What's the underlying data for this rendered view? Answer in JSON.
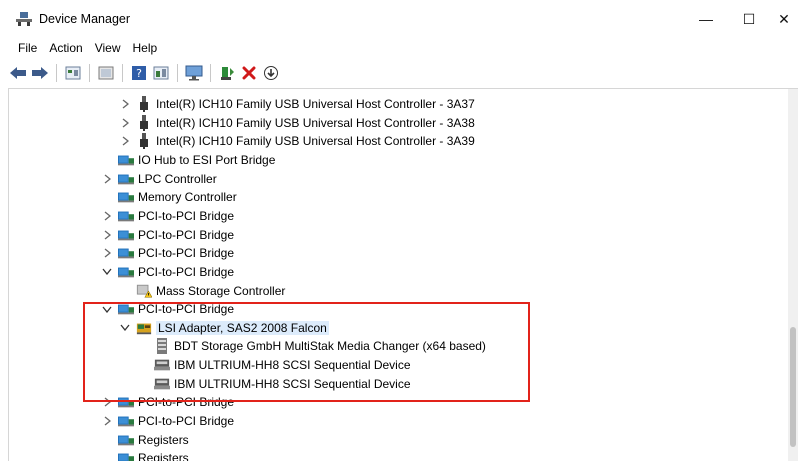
{
  "window": {
    "title": "Device Manager",
    "minimize_glyph": "—",
    "maximize_glyph": "☐",
    "close_glyph": "✕"
  },
  "menu": [
    "File",
    "Action",
    "View",
    "Help"
  ],
  "toolbar_icons": [
    "back-icon",
    "forward-icon",
    "properties-icon",
    "show-hidden-icon",
    "help-icon",
    "details-icon",
    "monitor-icon",
    "update-driver-icon",
    "uninstall-icon",
    "scan-icon"
  ],
  "tree": [
    {
      "label": "Intel(R) ICH10 Family USB Universal Host Controller - 3A37",
      "icon": "usb-icon",
      "expander": "collapsed"
    },
    {
      "label": "Intel(R) ICH10 Family USB Universal Host Controller - 3A38",
      "icon": "usb-icon",
      "expander": "collapsed"
    },
    {
      "label": "Intel(R) ICH10 Family USB Universal Host Controller - 3A39",
      "icon": "usb-icon",
      "expander": "collapsed"
    },
    {
      "label": "IO Hub to ESI Port Bridge",
      "icon": "system-device-icon",
      "expander": "none"
    },
    {
      "label": "LPC Controller",
      "icon": "system-device-icon",
      "expander": "collapsed"
    },
    {
      "label": "Memory Controller",
      "icon": "system-device-icon",
      "expander": "none"
    },
    {
      "label": "PCI-to-PCI Bridge",
      "icon": "system-device-icon",
      "expander": "collapsed"
    },
    {
      "label": "PCI-to-PCI Bridge",
      "icon": "system-device-icon",
      "expander": "collapsed"
    },
    {
      "label": "PCI-to-PCI Bridge",
      "icon": "system-device-icon",
      "expander": "collapsed"
    },
    {
      "label": "PCI-to-PCI Bridge",
      "icon": "system-device-icon",
      "expander": "expanded"
    },
    {
      "label": "Mass Storage Controller",
      "icon": "warning-device-icon",
      "expander": "none"
    },
    {
      "label": "PCI-to-PCI Bridge",
      "icon": "system-device-icon",
      "expander": "expanded"
    },
    {
      "label": "LSI Adapter, SAS2 2008 Falcon",
      "icon": "storage-controller-icon",
      "expander": "expanded"
    },
    {
      "label": "BDT Storage GmbH MultiStak Media Changer  (x64 based)",
      "icon": "media-changer-icon",
      "expander": "none"
    },
    {
      "label": "IBM ULTRIUM-HH8 SCSI Sequential Device",
      "icon": "tape-drive-icon",
      "expander": "none"
    },
    {
      "label": "IBM ULTRIUM-HH8 SCSI Sequential Device",
      "icon": "tape-drive-icon",
      "expander": "none"
    },
    {
      "label": "PCI-to-PCI Bridge",
      "icon": "system-device-icon",
      "expander": "collapsed"
    },
    {
      "label": "PCI-to-PCI Bridge",
      "icon": "system-device-icon",
      "expander": "collapsed"
    },
    {
      "label": "Registers",
      "icon": "system-device-icon",
      "expander": "none"
    },
    {
      "label": "Registers",
      "icon": "system-device-icon",
      "expander": "none"
    }
  ],
  "colors": {
    "highlight": "#e2231a",
    "selection": "#dcebfb"
  }
}
